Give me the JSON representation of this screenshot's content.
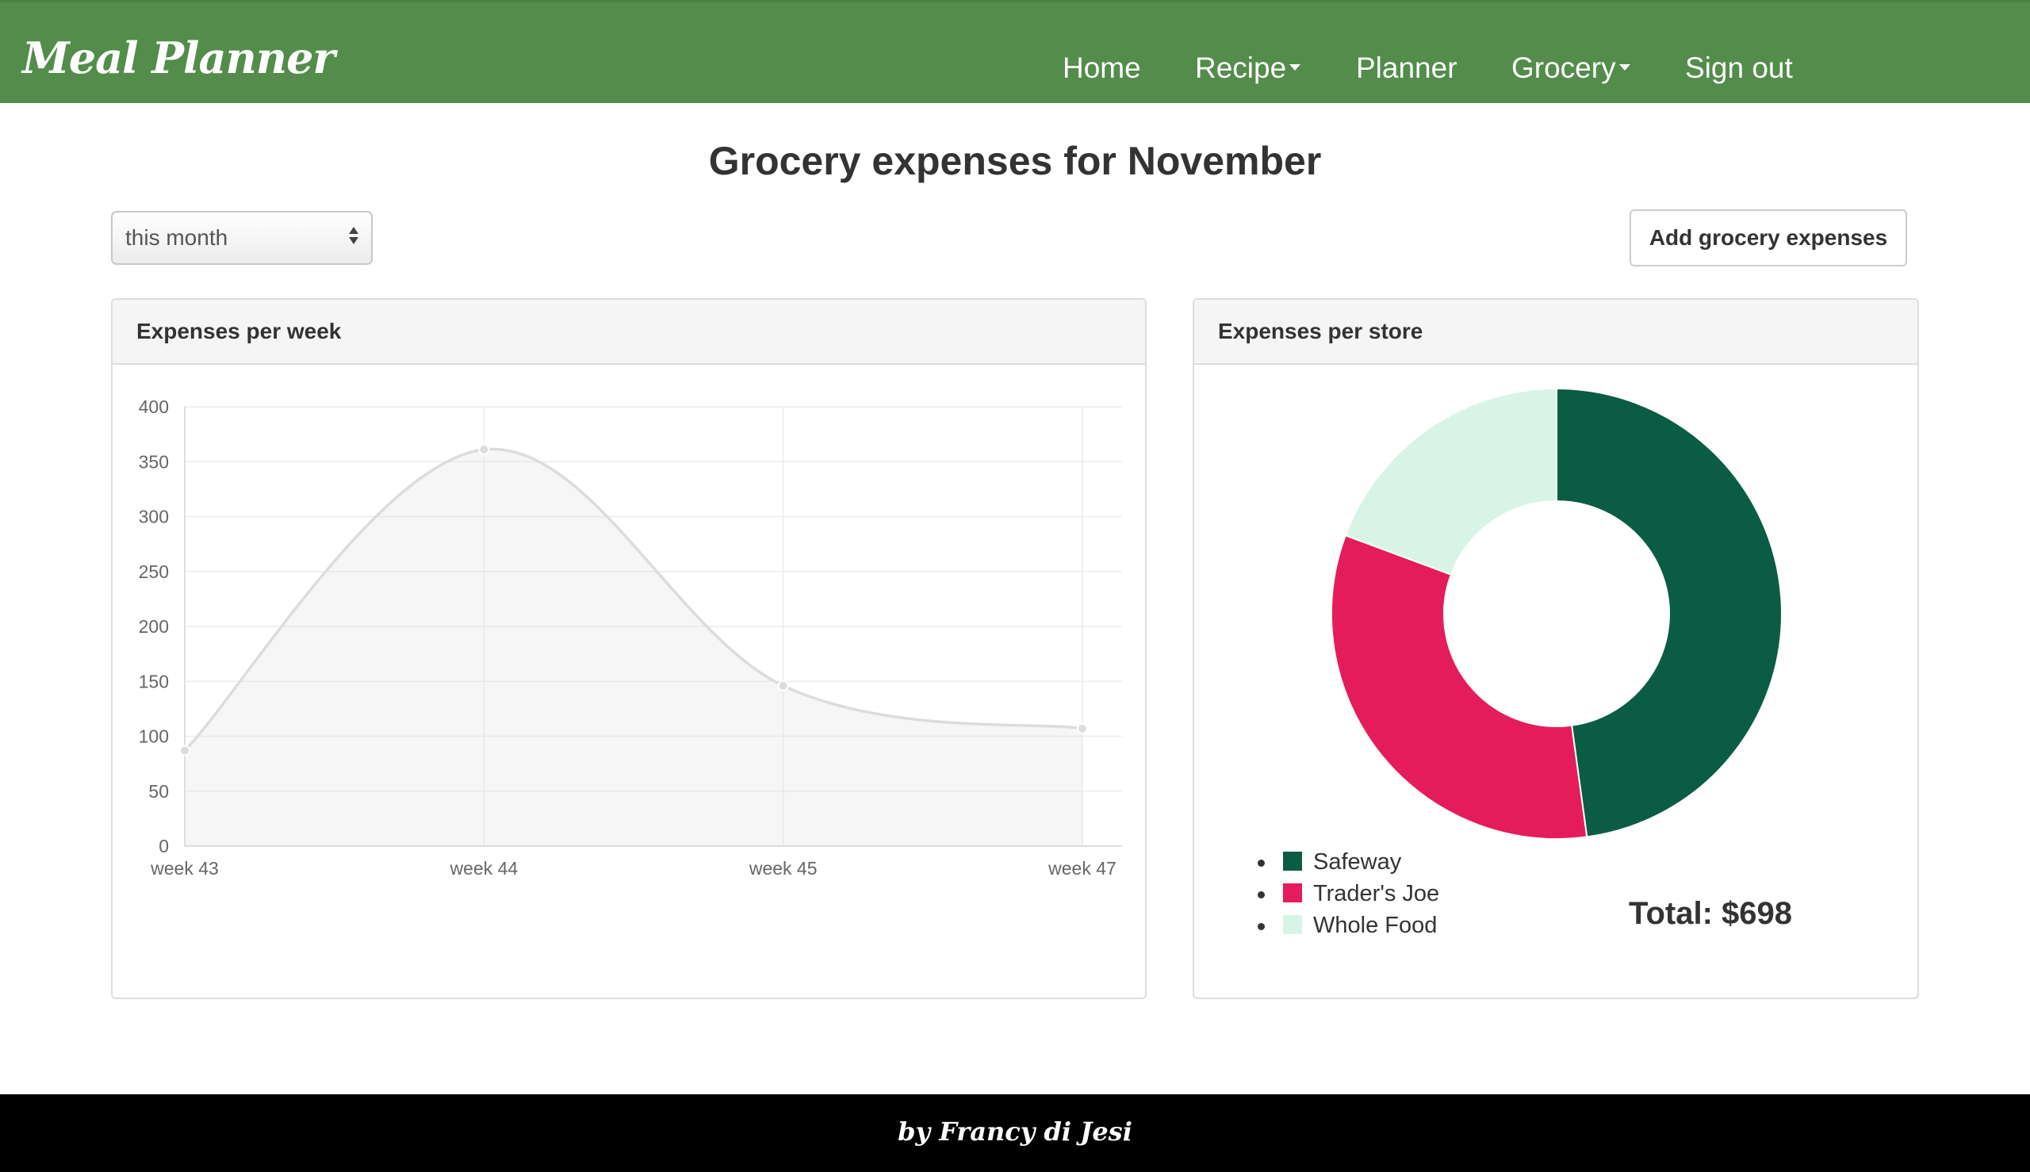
{
  "navbar": {
    "brand": "Meal Planner",
    "items": [
      {
        "label": "Home",
        "dropdown": false
      },
      {
        "label": "Recipe",
        "dropdown": true
      },
      {
        "label": "Planner",
        "dropdown": false
      },
      {
        "label": "Grocery",
        "dropdown": true
      },
      {
        "label": "Sign out",
        "dropdown": false
      }
    ]
  },
  "page": {
    "title": "Grocery expenses for November",
    "period_select": {
      "value": "this month"
    },
    "add_button": "Add grocery expenses"
  },
  "panels": {
    "weekly": {
      "title": "Expenses per week"
    },
    "store": {
      "title": "Expenses per store",
      "total": "Total: $698"
    }
  },
  "colors": {
    "navbar": "#538c4b",
    "safeway": "#0b5c44",
    "traders_joe": "#e51c5b",
    "whole_food": "#d8f4e6",
    "line": "#dcdcdc",
    "footer": "#000000"
  },
  "chart_data": [
    {
      "type": "line",
      "title": "Expenses per week",
      "categories": [
        "week 43",
        "week 44",
        "week 45",
        "week 47"
      ],
      "series": [
        {
          "values": [
            87,
            361,
            146,
            107
          ]
        }
      ],
      "ylim": [
        0,
        400
      ],
      "yticks": [
        0,
        50,
        100,
        150,
        200,
        250,
        300,
        350,
        400
      ],
      "grid": true,
      "area_fill": true,
      "smooth": true
    },
    {
      "type": "pie",
      "donut": true,
      "title": "Expenses per store",
      "slices": [
        {
          "label": "Safeway",
          "value": 334,
          "color": "#0b5c44"
        },
        {
          "label": "Trader's Joe",
          "value": 229,
          "color": "#e51c5b"
        },
        {
          "label": "Whole Food",
          "value": 135,
          "color": "#d8f4e6"
        }
      ],
      "legend": "bottom-left"
    }
  ],
  "footer": {
    "text": "by Francy di Jesi"
  }
}
